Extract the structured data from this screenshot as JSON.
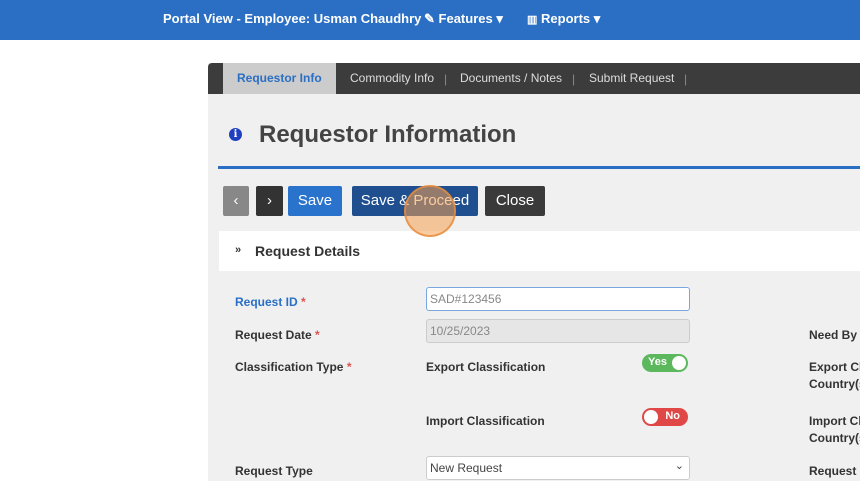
{
  "topbar": {
    "title": "Portal View - Employee: Usman Chaudhry",
    "features": "Features",
    "reports": "Reports"
  },
  "tabs": [
    "Requestor Info",
    "Commodity Info",
    "Documents / Notes",
    "Submit Request"
  ],
  "page_title": "Requestor Information",
  "buttons": {
    "prev": "‹",
    "next": "›",
    "save": "Save",
    "save_proceed": "Save & Proceed",
    "close": "Close"
  },
  "section": "Request Details",
  "form": {
    "request_id_label": "Request ID",
    "request_id_value": "SAD#123456",
    "request_date_label": "Request Date",
    "request_date_value": "10/25/2023",
    "classification_label": "Classification Type",
    "export_label": "Export Classification",
    "export_toggle": "Yes",
    "import_label": "Import Classification",
    "import_toggle": "No",
    "request_type_label": "Request Type",
    "request_type_value": "New Request",
    "need_by": "Need By",
    "export_country_1": "Export Cl",
    "export_country_2": "Country(s",
    "import_country_1": "Import Cl",
    "import_country_2": "Country(s",
    "request_right": "Request",
    "required": "*"
  },
  "colors": {
    "brand": "#2a6fc4",
    "yes": "#5cb85c",
    "no": "#e04848"
  }
}
